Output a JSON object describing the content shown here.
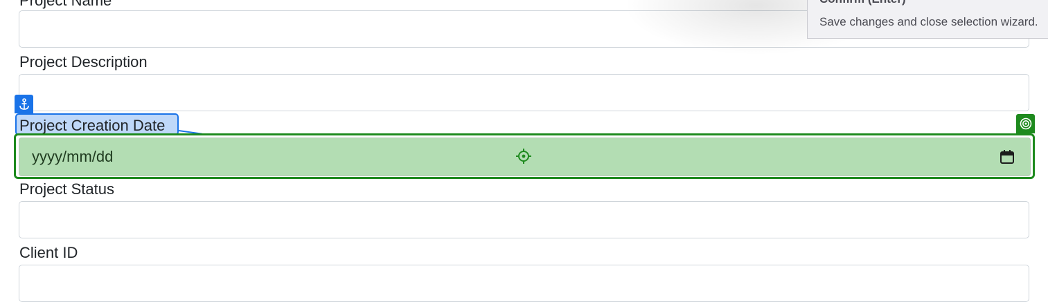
{
  "form": {
    "fields": [
      {
        "label": "Project Name",
        "value": ""
      },
      {
        "label": "Project Description",
        "value": ""
      },
      {
        "label": "Project Creation Date",
        "placeholder": "yyyy/mm/dd"
      },
      {
        "label": "Project Status",
        "value": ""
      },
      {
        "label": "Client ID",
        "value": ""
      }
    ]
  },
  "tooltip": {
    "title": "Confirm (Enter)",
    "description": "Save changes and close selection wizard."
  },
  "icons": {
    "anchor": "anchor-icon",
    "target": "target-icon",
    "crosshair": "crosshair-icon",
    "calendar": "calendar-icon"
  },
  "colors": {
    "label_highlight": "#1a73e8",
    "input_highlight": "#1e8a1e",
    "input_fill": "#b3ddb3"
  }
}
